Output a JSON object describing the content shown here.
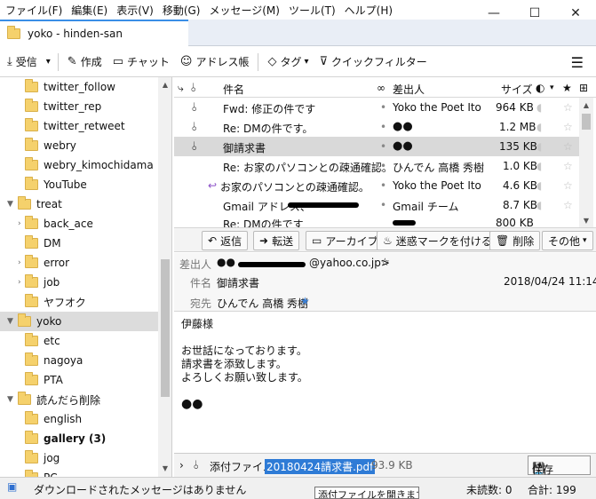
{
  "menu": [
    "ファイル(F)",
    "編集(E)",
    "表示(V)",
    "移動(G)",
    "メッセージ(M)",
    "ツール(T)",
    "ヘルプ(H)"
  ],
  "window_controls": {
    "minimize": "—",
    "maximize": "☐",
    "close": "✕"
  },
  "tab": {
    "title": "yoko - hinden-san"
  },
  "toolbar": {
    "get_mail": "受信",
    "write": "作成",
    "chat": "チャット",
    "address_book": "アドレス帳",
    "tag": "タグ",
    "quick_filter": "クイックフィルター"
  },
  "folders": [
    {
      "name": "twitter_follow"
    },
    {
      "name": "twitter_rep"
    },
    {
      "name": "twitter_retweet"
    },
    {
      "name": "webry"
    },
    {
      "name": "webry_kimochidama"
    },
    {
      "name": "YouTube"
    },
    {
      "name": "treat"
    },
    {
      "name": "back_ace"
    },
    {
      "name": "DM"
    },
    {
      "name": "error"
    },
    {
      "name": "job"
    },
    {
      "name": "ヤフオク"
    },
    {
      "name": "yoko"
    },
    {
      "name": "etc"
    },
    {
      "name": "nagoya"
    },
    {
      "name": "PTA"
    },
    {
      "name": "読んだら削除"
    },
    {
      "name": "english"
    },
    {
      "name": "gallery (3)"
    },
    {
      "name": "jog"
    },
    {
      "name": "PC"
    }
  ],
  "columns": {
    "subject": "件名",
    "from": "差出人",
    "size": "サイズ"
  },
  "messages": [
    {
      "subject": "Fwd: 修正の件です",
      "from": "Yoko the Poet Ito",
      "size": "964 KB"
    },
    {
      "subject": "Re: DMの件です。",
      "from": "",
      "size": "1.2 MB"
    },
    {
      "subject": "御請求書",
      "from": "",
      "size": "135 KB"
    },
    {
      "subject": "Re: お家のパソコンとの疎通確認。",
      "from": "ひんでん 高橋 秀樹",
      "size": "1.0 KB"
    },
    {
      "subject": "お家のパソコンとの疎通確認。",
      "from": "Yoko the Poet Ito",
      "size": "4.6 KB"
    },
    {
      "subject": "Gmail アドレス、",
      "from": "Gmail チーム",
      "size": "8.7 KB"
    },
    {
      "subject": "Re: DMの件です",
      "from": "",
      "size": "800 KB"
    }
  ],
  "actions": {
    "reply": "返信",
    "forward": "転送",
    "archive": "アーカイブ",
    "junk": "迷惑マークを付ける",
    "delete": "削除",
    "other": "その他"
  },
  "header": {
    "from_label": "差出人",
    "from_suffix": "@yahoo.co.jp>",
    "subject_label": "件名",
    "subject": "御請求書",
    "date": "2018/04/24 11:14",
    "to_label": "宛先",
    "to": "ひんでん 高橋 秀樹"
  },
  "body": [
    "伊藤様",
    "",
    "お世話になっております。",
    "請求書を添致します。",
    "よろしくお願い致します。",
    ""
  ],
  "attachment": {
    "label": "添付ファイル:",
    "name": "20180424請求書.pdf",
    "size": "93.9 KB",
    "save": "保存"
  },
  "status": {
    "text": "ダウンロードされたメッセージはありません",
    "unread": "未読数: 0",
    "total": "合計: 199"
  },
  "tooltip": "添付ファイルを開きます",
  "colors": {
    "accent": "#2e7bd6",
    "folder": "#f5d16c",
    "star": "#3a7fd5"
  }
}
